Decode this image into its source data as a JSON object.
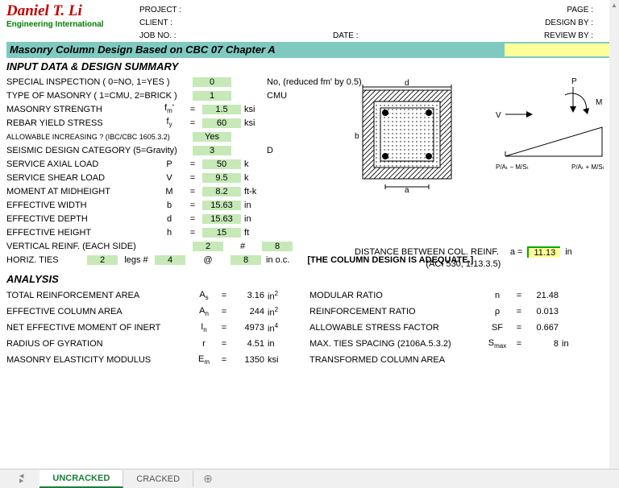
{
  "header": {
    "logo_name": "Daniel T. Li",
    "logo_sub": "Engineering International",
    "project": "PROJECT :",
    "client": "CLIENT :",
    "jobno": "JOB NO. :",
    "date": "DATE :",
    "page": "PAGE :",
    "designby": "DESIGN BY :",
    "reviewby": "REVIEW BY :"
  },
  "title": "Masonry Column Design Based on CBC 07 Chapter A",
  "input_heading": "INPUT DATA & DESIGN SUMMARY",
  "inputs": [
    {
      "label": "SPECIAL INSPECTION ( 0=NO, 1=YES )",
      "sym": "",
      "eq": "",
      "val": "0",
      "unit": "",
      "note": "No, (reduced fm' by 0.5)"
    },
    {
      "label": "TYPE OF MASONRY ( 1=CMU, 2=BRICK )",
      "sym": "",
      "eq": "",
      "val": "1",
      "unit": "",
      "note": "CMU"
    },
    {
      "label": "MASONRY STRENGTH",
      "sym": "f<sub>m</sub>'",
      "eq": "=",
      "val": "1.5",
      "unit": "ksi",
      "note": ""
    },
    {
      "label": "REBAR YIELD STRESS",
      "sym": "f<sub>y</sub>",
      "eq": "=",
      "val": "60",
      "unit": "ksi",
      "note": ""
    },
    {
      "label": "ALLOWABLE INCREASING ? (IBC/CBC 1605.3.2)",
      "sym": "",
      "eq": "",
      "val": "Yes",
      "unit": "",
      "note": "",
      "small": true
    },
    {
      "label": "SEISMIC DESIGN CATEGORY (5=Gravity)",
      "sym": "",
      "eq": "",
      "val": "3",
      "unit": "",
      "note": "D"
    },
    {
      "label": "SERVICE AXIAL LOAD",
      "sym": "P",
      "eq": "=",
      "val": "50",
      "unit": "k",
      "note": ""
    },
    {
      "label": "SERVICE SHEAR LOAD",
      "sym": "V",
      "eq": "=",
      "val": "9.5",
      "unit": "k",
      "note": ""
    },
    {
      "label": "MOMENT AT MIDHEIGHT",
      "sym": "M",
      "eq": "=",
      "val": "8.2",
      "unit": "ft-k",
      "note": ""
    },
    {
      "label": "EFFECTIVE WIDTH",
      "sym": "b",
      "eq": "=",
      "val": "15.63",
      "unit": "in",
      "note": ""
    },
    {
      "label": "EFFECTIVE DEPTH",
      "sym": "d",
      "eq": "=",
      "val": "15.63",
      "unit": "in",
      "note": ""
    },
    {
      "label": "EFFECTIVE HEIGHT",
      "sym": "h",
      "eq": "=",
      "val": "15",
      "unit": "ft",
      "note": ""
    }
  ],
  "vert_reinf": {
    "label": "VERTICAL REINF. (EACH SIDE)",
    "v1": "2",
    "mid": "#",
    "v2": "8"
  },
  "horiz": {
    "label": "HORIZ. TIES",
    "legs": "2",
    "legs_lbl": "legs #",
    "size": "4",
    "at": "@",
    "spacing": "8",
    "unit": "in o.c."
  },
  "dist": {
    "label": "DISTANCE BETWEEN COL. REINF.",
    "sym": "a =",
    "val": "11.13",
    "unit": "in",
    "ref": "(ACI 530, 1.13.3.5)"
  },
  "adequate": "[THE COLUMN DESIGN IS ADEQUATE.]",
  "analysis_heading": "ANALYSIS",
  "analysis": [
    {
      "l": "TOTAL REINFORCEMENT AREA",
      "ls": "A<sub>s</sub>",
      "le": "=",
      "lv": "3.16",
      "lu": "in<sup>2</sup>",
      "r": "MODULAR RATIO",
      "rs": "n",
      "re": "=",
      "rv": "21.48",
      "ru": ""
    },
    {
      "l": "EFFECTIVE COLUMN AREA",
      "ls": "A<sub>n</sub>",
      "le": "=",
      "lv": "244",
      "lu": "in<sup>2</sup>",
      "r": "REINFORCEMENT RATIO",
      "rs": "ρ",
      "re": "=",
      "rv": "0.013",
      "ru": ""
    },
    {
      "l": "NET EFFECTIVE MOMENT OF INERT",
      "ls": "I<sub>n</sub>",
      "le": "=",
      "lv": "4973",
      "lu": "in<sup>4</sup>",
      "r": "ALLOWABLE STRESS FACTOR",
      "rs": "SF",
      "re": "=",
      "rv": "0.667",
      "ru": ""
    },
    {
      "l": "RADIUS OF GYRATION",
      "ls": "r",
      "le": "=",
      "lv": "4.51",
      "lu": "in",
      "r": "MAX. TIES SPACING (2106A.5.3.2)",
      "rs": "S<sub>max</sub>",
      "re": "=",
      "rv": "8",
      "ru": "in"
    },
    {
      "l": "MASONRY ELASTICITY MODULUS",
      "ls": "E<sub>m</sub>",
      "le": "=",
      "lv": "1350",
      "lu": "ksi",
      "r": "TRANSFORMED COLUMN AREA",
      "rs": "",
      "re": "",
      "rv": "",
      "ru": ""
    }
  ],
  "tabs": {
    "active": "UNCRACKED",
    "other": "CRACKED"
  },
  "diagram": {
    "d_label": "d",
    "a_label": "a",
    "b_label": "b",
    "p": "P",
    "m": "M",
    "v": "V",
    "left_eq": "P/Aₜ − M/Sₜ",
    "right_eq": "P/Aₜ + M/Sₜ"
  }
}
